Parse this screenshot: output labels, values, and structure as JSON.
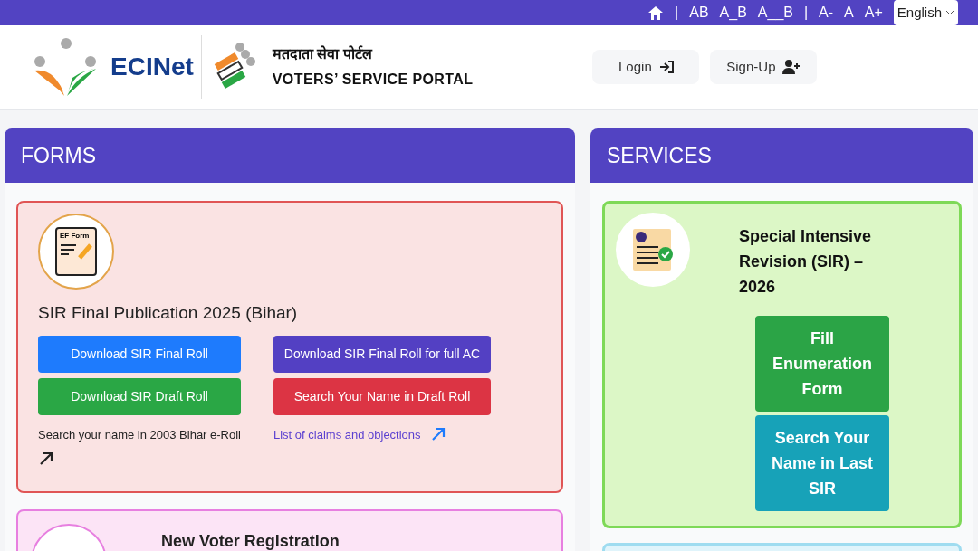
{
  "top_bar": {
    "separators": [
      "|",
      "|"
    ],
    "spacing_options": [
      "AB",
      "A_B",
      "A__B"
    ],
    "font_size_options": [
      "A-",
      "A",
      "A+"
    ],
    "language": "English"
  },
  "header": {
    "logo_text": "ECINet",
    "portal_title_hindi": "मतदाता सेवा पोर्टल",
    "portal_title": "VOTERS’ SERVICE PORTAL",
    "buttons": [
      {
        "label": "Login",
        "kind": "login"
      },
      {
        "label": "Sign-Up",
        "kind": "signup"
      }
    ]
  },
  "forms": {
    "title": "FORMS",
    "cards": [
      {
        "icon_label": "EF Form",
        "title": "SIR Final Publication 2025 (Bihar)",
        "buttons": [
          {
            "label": "Download SIR Final Roll",
            "color": "#1e7bfd"
          },
          {
            "label": "Download SIR Final Roll for full AC",
            "color": "#5340c3"
          },
          {
            "label": "Download SIR Draft Roll",
            "color": "#2aa745"
          },
          {
            "label": "Search Your Name in Draft Roll",
            "color": "#dc3444"
          }
        ],
        "links": [
          {
            "label": "Search your name in 2003 Bihar e-Roll",
            "color": "#222222"
          },
          {
            "label": "List of claims and objections",
            "color": "#5a3fd0"
          }
        ]
      },
      {
        "title": "New Voter Registration"
      }
    ]
  },
  "services": {
    "title": "SERVICES",
    "cards": [
      {
        "title": "Special Intensive Revision (SIR) – 2026",
        "buttons": [
          {
            "label": "Fill Enumeration Form",
            "color": "#2ba446"
          },
          {
            "label": "Search Your Name in Last SIR",
            "color": "#17a2b8"
          }
        ]
      }
    ]
  }
}
